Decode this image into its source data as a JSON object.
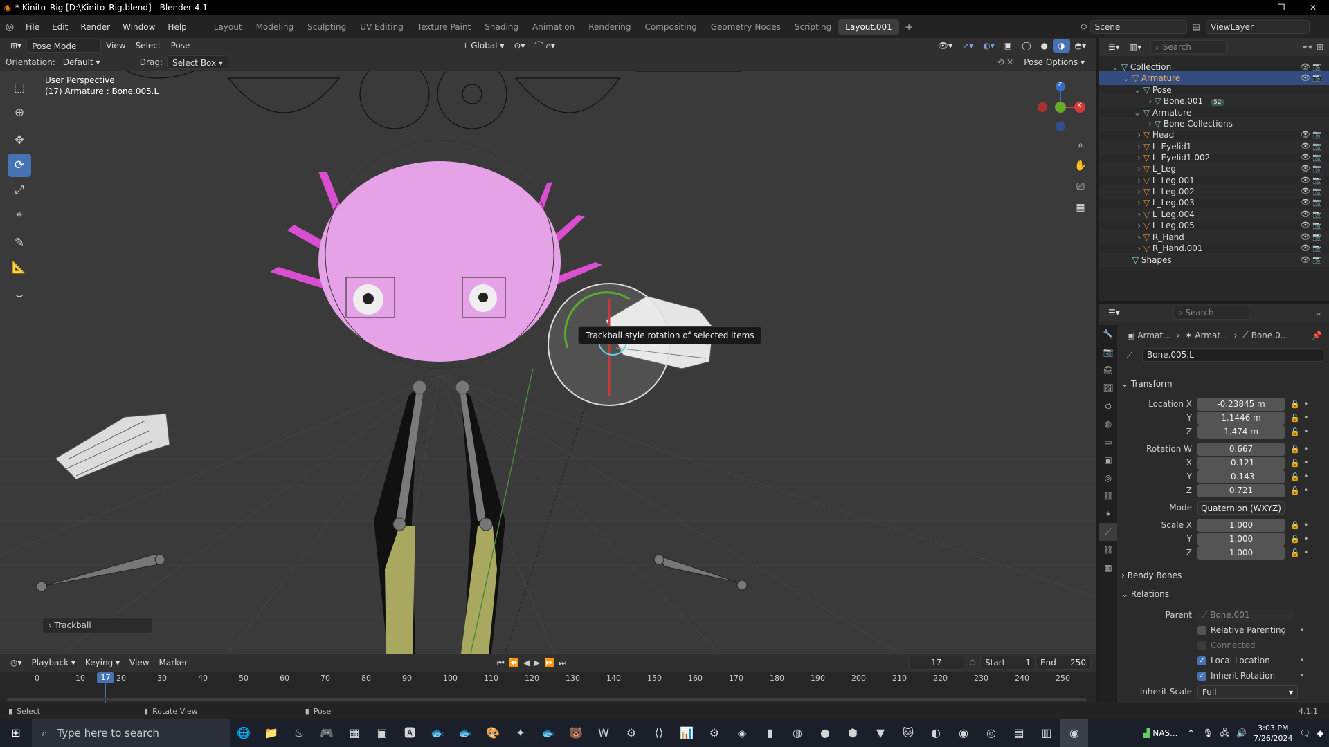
{
  "window": {
    "title": "* Kinito_Rig [D:\\Kinito_Rig.blend] - Blender 4.1"
  },
  "menu": [
    "File",
    "Edit",
    "Render",
    "Window",
    "Help"
  ],
  "workspaces": [
    "Layout",
    "Modeling",
    "Sculpting",
    "UV Editing",
    "Texture Paint",
    "Shading",
    "Animation",
    "Rendering",
    "Compositing",
    "Geometry Nodes",
    "Scripting",
    "Layout.001"
  ],
  "scene": {
    "label": "Scene",
    "view_layer": "ViewLayer"
  },
  "viewport_header": {
    "mode": "Pose Mode",
    "view": "View",
    "select": "Select",
    "pose": "Pose",
    "transform": "Global"
  },
  "tool_settings": {
    "orientation_label": "Orientation:",
    "orientation": "Default",
    "drag_label": "Drag:",
    "drag": "Select Box",
    "pose_options": "Pose Options"
  },
  "overlay_text": {
    "perspective": "User Perspective",
    "object": "(17) Armature : Bone.005.L"
  },
  "tooltip": "Trackball style rotation of selected items",
  "operator_panel": "Trackball",
  "gizmo": {
    "z": "Z",
    "y": "Y",
    "x": "X"
  },
  "timeline": {
    "menus": [
      "Playback",
      "Keying",
      "View",
      "Marker"
    ],
    "current_frame": "17",
    "start_label": "Start",
    "start": "1",
    "end_label": "End",
    "end": "250",
    "ruler": [
      "0",
      "10",
      "20",
      "30",
      "40",
      "50",
      "60",
      "70",
      "80",
      "90",
      "100",
      "110",
      "120",
      "130",
      "140",
      "150",
      "160",
      "170",
      "180",
      "190",
      "200",
      "210",
      "220",
      "230",
      "240",
      "250"
    ],
    "playhead": "17"
  },
  "statusbar": {
    "left": "Select",
    "middle": "Rotate View",
    "right": "Pose",
    "version": "4.1.1"
  },
  "outliner": {
    "search_placeholder": "Search",
    "rows": [
      {
        "label": "Collection",
        "indent": 0
      },
      {
        "label": "Armature",
        "indent": 1
      },
      {
        "label": "Pose",
        "indent": 2
      },
      {
        "label": "Bone.001",
        "indent": 3
      },
      {
        "label": "Armature",
        "indent": 2
      },
      {
        "label": "Bone Collections",
        "indent": 3
      },
      {
        "label": "Head",
        "indent": 2
      },
      {
        "label": "L_Eyelid1",
        "indent": 2
      },
      {
        "label": "L_Eyelid1.002",
        "indent": 2
      },
      {
        "label": "L_Leg",
        "indent": 2
      },
      {
        "label": "L_Leg.001",
        "indent": 2
      },
      {
        "label": "L_Leg.002",
        "indent": 2
      },
      {
        "label": "L_Leg.003",
        "indent": 2
      },
      {
        "label": "L_Leg.004",
        "indent": 2
      },
      {
        "label": "L_Leg.005",
        "indent": 2
      },
      {
        "label": "R_Hand",
        "indent": 2
      },
      {
        "label": "R_Hand.001",
        "indent": 2
      },
      {
        "label": "Shapes",
        "indent": 1
      }
    ],
    "badge": "52"
  },
  "properties": {
    "search_placeholder": "Search",
    "breadcrumb": [
      "Armat...",
      "Armat...",
      "Bone.0..."
    ],
    "bone_name": "Bone.005.L",
    "transform": {
      "title": "Transform",
      "location_label": "Location X",
      "location": [
        "-0.23845 m",
        "1.1446 m",
        "1.474 m"
      ],
      "rotation_label": "Rotation W",
      "rotation": [
        "0.667",
        "-0.121",
        "-0.143",
        "0.721"
      ],
      "mode_label": "Mode",
      "mode": "Quaternion (WXYZ)",
      "scale_label": "Scale X",
      "scale": [
        "1.000",
        "1.000",
        "1.000"
      ],
      "axis": {
        "x": "X",
        "y": "Y",
        "z": "Z"
      }
    },
    "bendy_bones": "Bendy Bones",
    "relations": {
      "title": "Relations",
      "parent_label": "Parent",
      "parent": "Bone.001",
      "relative_parenting": "Relative Parenting",
      "connected": "Connected",
      "local_location": "Local Location",
      "inherit_rotation": "Inherit Rotation",
      "inherit_scale_label": "Inherit Scale",
      "inherit_scale": "Full"
    }
  },
  "taskbar": {
    "search_placeholder": "Type here to search",
    "time": "3:03 PM",
    "date": "7/26/2024",
    "tray_label": "NAS..."
  },
  "colors": {
    "accent": "#4772b3",
    "selected_row": "#334d80",
    "body_pink": "#e79ce7",
    "leg_olive": "#a8a860"
  }
}
